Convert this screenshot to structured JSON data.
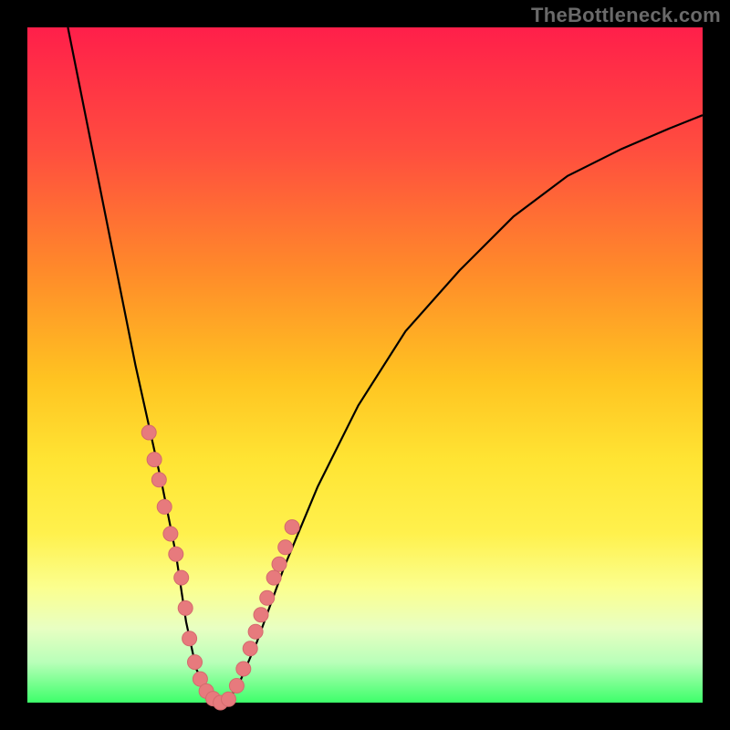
{
  "watermark": "TheBottleneck.com",
  "colors": {
    "curve": "#000000",
    "marker_fill": "#e77a7d",
    "marker_stroke": "#d46a6d"
  },
  "chart_data": {
    "type": "line",
    "title": "",
    "xlabel": "",
    "ylabel": "",
    "xlim": [
      0,
      100
    ],
    "ylim": [
      0,
      100
    ],
    "grid": false,
    "legend": false,
    "series": [
      {
        "name": "curve",
        "x": [
          6,
          8,
          10,
          12,
          14,
          16,
          18,
          20,
          22,
          23.5,
          25,
          27,
          29,
          31,
          34,
          38,
          43,
          49,
          56,
          64,
          72,
          80,
          88,
          95,
          100
        ],
        "values": [
          100,
          90,
          80,
          70,
          60,
          50,
          41,
          32,
          22,
          12,
          5,
          1,
          0,
          2,
          9,
          20,
          32,
          44,
          55,
          64,
          72,
          78,
          82,
          85,
          87
        ]
      }
    ],
    "markers": [
      {
        "x": 18.0,
        "y": 40.0
      },
      {
        "x": 18.8,
        "y": 36.0
      },
      {
        "x": 19.5,
        "y": 33.0
      },
      {
        "x": 20.3,
        "y": 29.0
      },
      {
        "x": 21.2,
        "y": 25.0
      },
      {
        "x": 22.0,
        "y": 22.0
      },
      {
        "x": 22.8,
        "y": 18.5
      },
      {
        "x": 23.4,
        "y": 14.0
      },
      {
        "x": 24.0,
        "y": 9.5
      },
      {
        "x": 24.8,
        "y": 6.0
      },
      {
        "x": 25.6,
        "y": 3.5
      },
      {
        "x": 26.5,
        "y": 1.7
      },
      {
        "x": 27.5,
        "y": 0.6
      },
      {
        "x": 28.6,
        "y": 0.0
      },
      {
        "x": 29.8,
        "y": 0.5
      },
      {
        "x": 31.0,
        "y": 2.5
      },
      {
        "x": 32.0,
        "y": 5.0
      },
      {
        "x": 33.0,
        "y": 8.0
      },
      {
        "x": 33.8,
        "y": 10.5
      },
      {
        "x": 34.6,
        "y": 13.0
      },
      {
        "x": 35.5,
        "y": 15.5
      },
      {
        "x": 36.5,
        "y": 18.5
      },
      {
        "x": 37.3,
        "y": 20.5
      },
      {
        "x": 38.2,
        "y": 23.0
      },
      {
        "x": 39.2,
        "y": 26.0
      }
    ]
  }
}
